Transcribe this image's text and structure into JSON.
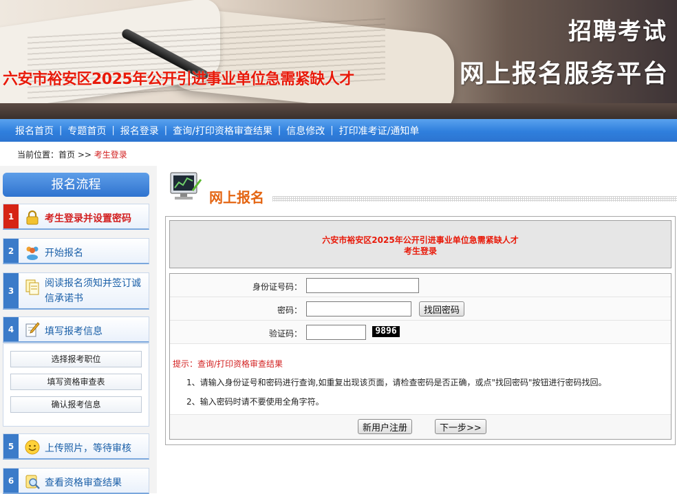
{
  "banner": {
    "title": "六安市裕安区2025年公开引进事业单位急需紧缺人才",
    "right_line1": "招聘考试",
    "right_line2": "网上报名服务平台"
  },
  "nav": {
    "items": [
      "报名首页",
      "专题首页",
      "报名登录",
      "查询/打印资格审查结果",
      "信息修改",
      "打印准考证/通知单"
    ],
    "separator": "|"
  },
  "breadcrumb": {
    "prefix": "当前位置：",
    "home": "首页",
    "arrow": ">>",
    "current": "考生登录"
  },
  "sidebar": {
    "header": "报名流程",
    "steps": [
      {
        "num": "1",
        "label": "考生登录并设置密码",
        "icon": "lock-icon"
      },
      {
        "num": "2",
        "label": "开始报名",
        "icon": "users-icon"
      },
      {
        "num": "3",
        "label_line1": "阅读报名须知并签订诚",
        "label_line2": "信承诺书",
        "icon": "documents-icon"
      },
      {
        "num": "4",
        "label": "填写报考信息",
        "icon": "edit-icon"
      },
      {
        "num": "5",
        "label": "上传照片，等待审核",
        "icon": "smile-icon"
      },
      {
        "num": "6",
        "label": "查看资格审查结果",
        "icon": "search-doc-icon"
      }
    ],
    "sub_items": [
      "选择报考职位",
      "填写资格审查表",
      "确认报考信息"
    ]
  },
  "main": {
    "section_title": "网上报名",
    "form_header_line1": "六安市裕安区2025年公开引进事业单位急需紧缺人才",
    "form_header_line2": "考生登录",
    "id_label": "身份证号码：",
    "id_value": "",
    "password_label": "密码：",
    "password_value": "",
    "find_password_button": "找回密码",
    "captcha_label": "验证码：",
    "captcha_value": "",
    "captcha_image_text": "9896",
    "tip_title": "提示：",
    "tip_link": "查询/打印资格审查结果",
    "tip1": "1、请输入身份证号和密码进行查询,如重复出现该页面，请检查密码是否正确，或点\"找回密码\"按钮进行密码找回。",
    "tip2": "2、输入密码时请不要使用全角字符。",
    "register_button": "新用户注册",
    "next_button": "下一步>>"
  },
  "colors": {
    "nav_blue": "#2f7fdd",
    "accent_red": "#e81a0a",
    "title_orange": "#e46512"
  }
}
